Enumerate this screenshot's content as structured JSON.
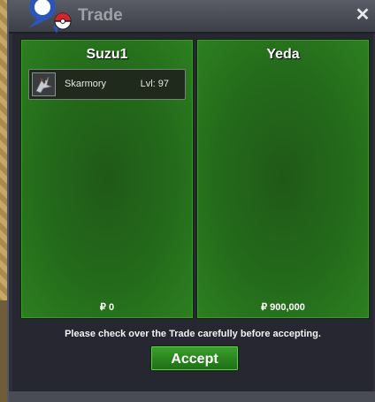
{
  "window": {
    "title": "Trade",
    "close_label": "✕",
    "logo_icon": "pokeball-logo-icon"
  },
  "trade": {
    "left": {
      "name": "Suzu1",
      "items": [
        {
          "name": "Skarmory",
          "level": "Lvl: 97",
          "icon": "skarmory-sprite-icon"
        }
      ],
      "money": "₽ 0"
    },
    "right": {
      "name": "Yeda",
      "items": [],
      "money": "₽ 900,000"
    },
    "notice": "Please check over the Trade carefully before accepting.",
    "accept_label": "Accept"
  },
  "colors": {
    "panel_green": "#246b1b",
    "button_green": "#2f8a22",
    "window_bg": "#262731",
    "pokeball_blue": "#2d55b8",
    "pokeball_red": "#d4232a"
  }
}
